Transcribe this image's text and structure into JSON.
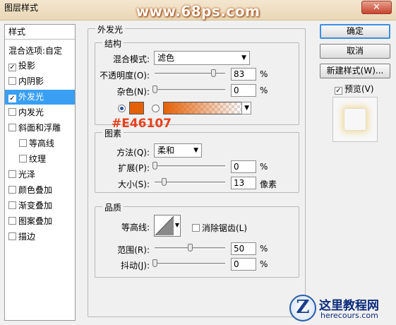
{
  "window": {
    "title": "图层样式",
    "close_glyph": "✕"
  },
  "watermark": "www.68ps.com",
  "left": {
    "header": "样式",
    "blend_options": "混合选项:自定",
    "items": [
      {
        "label": "投影",
        "checked": true
      },
      {
        "label": "内阴影",
        "checked": false
      },
      {
        "label": "外发光",
        "checked": true,
        "selected": true
      },
      {
        "label": "内发光",
        "checked": false
      },
      {
        "label": "斜面和浮雕",
        "checked": false
      },
      {
        "label": "等高线",
        "checked": false,
        "sub": true
      },
      {
        "label": "纹理",
        "checked": false,
        "sub": true
      },
      {
        "label": "光泽",
        "checked": false
      },
      {
        "label": "颜色叠加",
        "checked": false
      },
      {
        "label": "渐变叠加",
        "checked": false
      },
      {
        "label": "图案叠加",
        "checked": false
      },
      {
        "label": "描边",
        "checked": false
      }
    ],
    "check_glyph": "✓"
  },
  "outer_glow": {
    "title": "外发光",
    "structure": {
      "legend": "结构",
      "blend_mode_label": "混合模式:",
      "blend_mode_value": "滤色",
      "opacity_label": "不透明度(O):",
      "opacity_value": "83",
      "opacity_unit": "%",
      "noise_label": "杂色(N):",
      "noise_value": "0",
      "noise_unit": "%",
      "color": "#E46107"
    },
    "elements": {
      "legend": "图素",
      "method_label": "方法(Q):",
      "method_value": "柔和",
      "spread_label": "扩展(P):",
      "spread_value": "0",
      "spread_unit": "%",
      "size_label": "大小(S):",
      "size_value": "13",
      "size_unit": "像素"
    },
    "quality": {
      "legend": "品质",
      "contour_label": "等高线:",
      "antialias_label": "消除锯齿(L)",
      "range_label": "范围(R):",
      "range_value": "50",
      "range_unit": "%",
      "jitter_label": "抖动(J):",
      "jitter_value": "0",
      "jitter_unit": "%"
    }
  },
  "annotation": "#E46107",
  "buttons": {
    "ok": "确定",
    "cancel": "取消",
    "new_style": "新建样式(W)...",
    "preview_label": "预览(V)",
    "preview_checked": true
  },
  "logo": {
    "name": "这里教程网",
    "url": "herecours.com"
  },
  "icons": {
    "dropdown_arrow": "▼"
  }
}
